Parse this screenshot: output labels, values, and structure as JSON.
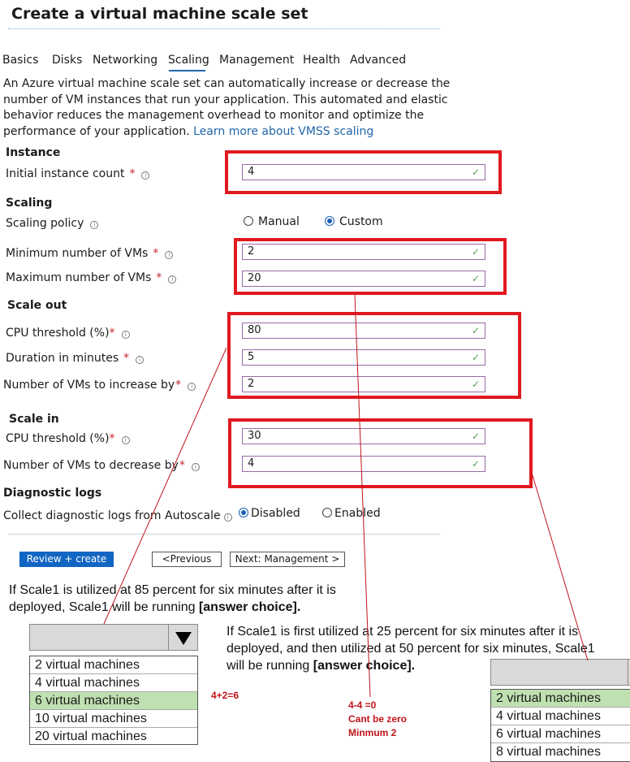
{
  "page": {
    "title": "Create a virtual machine scale set"
  },
  "tabs": [
    "Basics",
    "Disks",
    "Networking",
    "Scaling",
    "Management",
    "Health",
    "Advanced"
  ],
  "description": {
    "text": "An Azure virtual machine scale set can automatically increase or decrease the number of VM instances that run your application. This automated and elastic behavior reduces the management overhead to monitor and optimize the performance of your application.",
    "link": "Learn more about VMSS scaling"
  },
  "instance": {
    "heading": "Instance",
    "initial_label": "Initial instance count",
    "initial_value": "4"
  },
  "scaling": {
    "heading": "Scaling",
    "policy_label": "Scaling policy",
    "policy_options": [
      "Manual",
      "Custom"
    ],
    "policy_selected": "Custom",
    "min_label": "Minimum number of VMs",
    "min_value": "2",
    "max_label": "Maximum number of VMs",
    "max_value": "20"
  },
  "scale_out": {
    "heading": "Scale out",
    "cpu_label": "CPU threshold (%)",
    "cpu_value": "80",
    "duration_label": "Duration in minutes",
    "duration_value": "5",
    "increase_label": "Number of VMs to increase by",
    "increase_value": "2"
  },
  "scale_in": {
    "heading": "Scale in",
    "cpu_label": "CPU threshold (%)",
    "cpu_value": "30",
    "decrease_label": "Number of VMs to decrease by",
    "decrease_value": "4"
  },
  "diagnostics": {
    "heading": "Diagnostic logs",
    "collect_label": "Collect diagnostic logs from Autoscale",
    "options": [
      "Disabled",
      "Enabled"
    ],
    "selected": "Disabled"
  },
  "buttons": {
    "review_create": "Review + create",
    "previous": "<Previous",
    "next": "Next: Management >"
  },
  "question1": {
    "text": "If Scale1 is utilized at 85 percent for six minutes after it is deployed, Scale1 will be running",
    "answer_placeholder": "[answer choice].",
    "options": [
      "2 virtual machines",
      "4 virtual machines",
      "6 virtual machines",
      "10 virtual machines",
      "20 virtual machines"
    ],
    "selected": "6 virtual machines"
  },
  "question2": {
    "text": "If Scale1 is first utilized at 25 percent for six minutes after it is deployed, and then utilized at 50 percent for six minutes, Scale1 will be running",
    "answer_placeholder": "[answer choice].",
    "options": [
      "2 virtual machines",
      "4 virtual machines",
      "6 virtual machines",
      "8 virtual machines"
    ],
    "selected": "2 virtual machines"
  },
  "annotations": {
    "note1": "4+2=6",
    "note2_line1": "4-4 =0",
    "note2_line2": "Cant be zero",
    "note2_line3": "Minmum 2",
    "color": "#e0191f"
  }
}
